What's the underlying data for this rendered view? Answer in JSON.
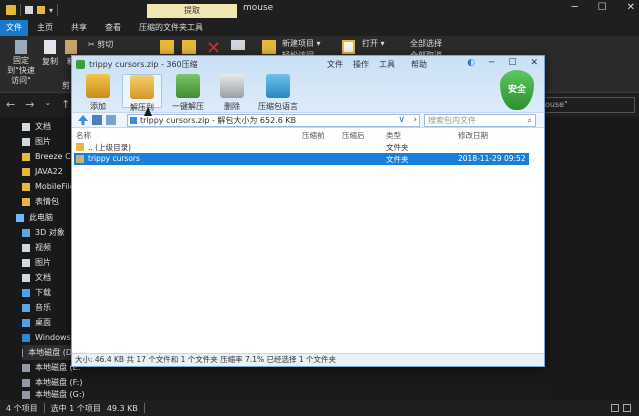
{
  "explorer": {
    "title": "mouse",
    "context_tab": "提取",
    "ribbon_tabs": [
      "文件",
      "主页",
      "共享",
      "查看",
      "压缩的文件夹工具"
    ],
    "ribbon": {
      "pin": "固定到\"快速访问\"",
      "copy": "复制",
      "paste": "粘",
      "cut": "剪切",
      "clipboard": "剪",
      "new_item": "新建项目",
      "easy_access": "轻松访问",
      "open": "打开",
      "select_all": "全部选择",
      "select_none": "全部取消"
    },
    "search_placeholder": "ouse\"",
    "sidebar": [
      {
        "label": "文档",
        "icon": "doc-icon"
      },
      {
        "label": "图片",
        "icon": "doc-icon"
      },
      {
        "label": "Breeze Curs",
        "icon": "folder-icon"
      },
      {
        "label": "JAVA22",
        "icon": "folder-icon"
      },
      {
        "label": "MobileFile",
        "icon": "folder-icon"
      },
      {
        "label": "表情包",
        "icon": "folder-icon"
      },
      {
        "label": "此电脑",
        "icon": "pc-icon"
      },
      {
        "label": "3D 对象",
        "icon": "cube-icon"
      },
      {
        "label": "视频",
        "icon": "video-icon"
      },
      {
        "label": "图片",
        "icon": "picture-icon"
      },
      {
        "label": "文档",
        "icon": "document-icon"
      },
      {
        "label": "下载",
        "icon": "download-icon"
      },
      {
        "label": "音乐",
        "icon": "music-icon"
      },
      {
        "label": "桌面",
        "icon": "desktop-icon"
      },
      {
        "label": "Windows (C",
        "icon": "windows-drive-icon"
      },
      {
        "label": "本地磁盘 (D",
        "icon": "drive-icon"
      },
      {
        "label": "本地磁盘 (E:",
        "icon": "drive-icon"
      },
      {
        "label": "本地磁盘 (F:)",
        "icon": "drive-icon"
      },
      {
        "label": "本地磁盘 (G:)",
        "icon": "drive-icon"
      }
    ],
    "status": {
      "items": "4 个项目",
      "selected": "选中 1 个项目",
      "size": "49.3 KB"
    }
  },
  "zip": {
    "title": "trippy cursors.zip - 360压缩",
    "menu": [
      "文件",
      "操作",
      "工具",
      "帮助"
    ],
    "toolbar": [
      {
        "label": "添加"
      },
      {
        "label": "解压到"
      },
      {
        "label": "一键解压"
      },
      {
        "label": "删除"
      },
      {
        "label": "压缩包语言"
      }
    ],
    "security_badge": "安全",
    "address": "trippy cursors.zip - 解包大小为 652.6 KB",
    "search_placeholder": "搜索包内文件",
    "columns": [
      "名称",
      "压缩前",
      "压缩后",
      "类型",
      "修改日期"
    ],
    "rows": [
      {
        "name": ".. (上级目录)",
        "before": "",
        "after": "",
        "type": "文件夹",
        "date": ""
      },
      {
        "name": "trippy cursors",
        "before": "",
        "after": "",
        "type": "文件夹",
        "date": "2018-11-29 09:52"
      }
    ],
    "status": "大小: 46.4 KB 共 17 个文件和 1 个文件夹 压缩率 7.1% 已经选择 1 个文件夹"
  }
}
